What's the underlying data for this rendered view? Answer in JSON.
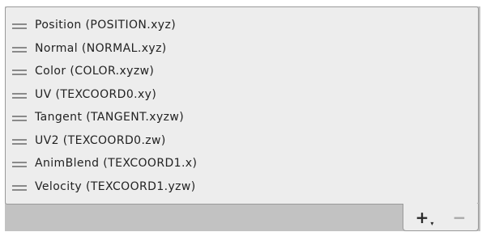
{
  "list": {
    "items": [
      {
        "label": "Position (POSITION.xyz)"
      },
      {
        "label": "Normal (NORMAL.xyz)"
      },
      {
        "label": "Color (COLOR.xyzw)"
      },
      {
        "label": "UV (TEXCOORD0.xy)"
      },
      {
        "label": "Tangent (TANGENT.xyzw)"
      },
      {
        "label": "UV2 (TEXCOORD0.zw)"
      },
      {
        "label": "AnimBlend (TEXCOORD1.x)"
      },
      {
        "label": "Velocity (TEXCOORD1.yzw)"
      }
    ]
  },
  "footer": {
    "add_label": "+",
    "add_caret": "▾",
    "remove_label": "−"
  },
  "icons": {
    "handle": "drag-handle-icon"
  },
  "colors": {
    "list_background": "#ededed",
    "panel_background": "#c2c2c2",
    "text": "#222222"
  }
}
